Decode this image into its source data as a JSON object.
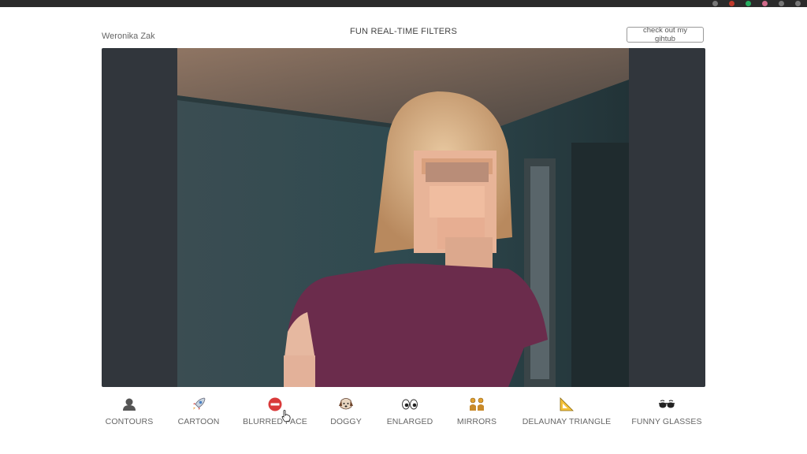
{
  "page": {
    "author": "Weronika Zak",
    "title": "FUN REAL-TIME FILTERS",
    "github_button": "check out my gihtub"
  },
  "filters": [
    {
      "label": "CONTOURS",
      "icon": "bust-silhouette-icon"
    },
    {
      "label": "CARTOON",
      "icon": "rocket-icon"
    },
    {
      "label": "BLURRED FACE",
      "icon": "no-entry-icon"
    },
    {
      "label": "DOGGY",
      "icon": "dog-face-icon"
    },
    {
      "label": "ENLARGED",
      "icon": "eyes-icon"
    },
    {
      "label": "MIRRORS",
      "icon": "people-icon"
    },
    {
      "label": "DELAUNAY TRIANGLE",
      "icon": "triangular-ruler-icon"
    },
    {
      "label": "FUNNY GLASSES",
      "icon": "sunglasses-icon"
    }
  ],
  "video": {
    "subject": "webcam-feed-with-blurred-face"
  }
}
